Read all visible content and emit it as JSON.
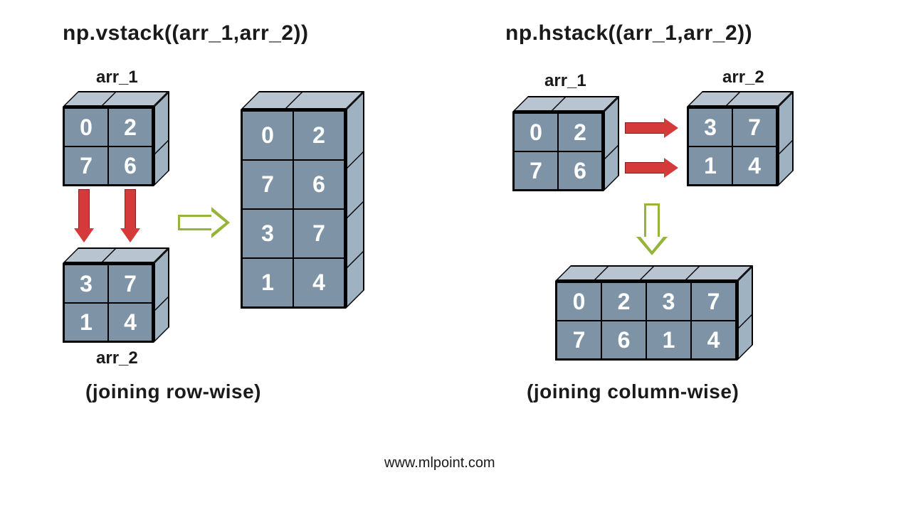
{
  "vstack": {
    "title": "np.vstack((arr_1,arr_2))",
    "arr1_label": "arr_1",
    "arr2_label": "arr_2",
    "arr1": [
      "0",
      "2",
      "7",
      "6"
    ],
    "arr2": [
      "3",
      "7",
      "1",
      "4"
    ],
    "result": [
      "0",
      "2",
      "7",
      "6",
      "3",
      "7",
      "1",
      "4"
    ],
    "caption": "(joining row-wise)"
  },
  "hstack": {
    "title": "np.hstack((arr_1,arr_2))",
    "arr1_label": "arr_1",
    "arr2_label": "arr_2",
    "arr1": [
      "0",
      "2",
      "7",
      "6"
    ],
    "arr2": [
      "3",
      "7",
      "1",
      "4"
    ],
    "result": [
      "0",
      "2",
      "3",
      "7",
      "7",
      "6",
      "1",
      "4"
    ],
    "caption": "(joining column-wise)"
  },
  "footer": "www.mlpoint.com"
}
